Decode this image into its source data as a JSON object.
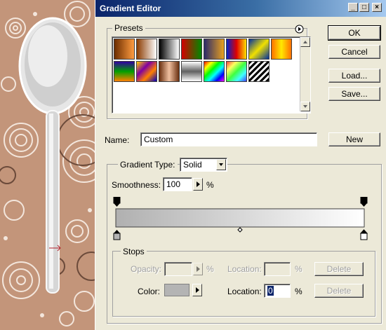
{
  "window": {
    "title": "Gradient Editor",
    "controls": [
      "_",
      "□",
      "×"
    ]
  },
  "presets": {
    "label": "Presets",
    "menu_icon": "circle-arrow-icon",
    "swatches": [
      {
        "name": "foreground-to-background",
        "css": "linear-gradient(90deg,#6b2d00,#ff9b40)"
      },
      {
        "name": "foreground-to-transparent",
        "css": "linear-gradient(90deg,#8b3b00,rgba(139,59,0,0))"
      },
      {
        "name": "black-white",
        "css": "linear-gradient(90deg,#000,#fff)"
      },
      {
        "name": "red-green",
        "css": "linear-gradient(90deg,#d40000,#008800)"
      },
      {
        "name": "violet-orange",
        "css": "linear-gradient(90deg,#2a2a6a,#e8a020)"
      },
      {
        "name": "blue-red-yellow",
        "css": "linear-gradient(90deg,#0022cc,#e00000,#ffe000)"
      },
      {
        "name": "blue-yellow-blue",
        "css": "linear-gradient(135deg,#0030a0,#f0e000 50%,#0030a0)"
      },
      {
        "name": "orange-yellow-orange",
        "css": "linear-gradient(90deg,#ff7000,#ffe800 50%,#ff7000)"
      },
      {
        "name": "violet-green-orange",
        "css": "linear-gradient(180deg,#3000a0,#00a000 50%,#ff8000)"
      },
      {
        "name": "yellow-violet-orange-blue",
        "css": "linear-gradient(135deg,#ffd000,#8000a0 35%,#ff8000 65%,#0000c0)"
      },
      {
        "name": "copper",
        "css": "linear-gradient(90deg,#6a3010,#f0c0a0 50%,#6a3010)"
      },
      {
        "name": "chrome",
        "css": "linear-gradient(180deg,#fff,#606060 50%,#fff)"
      },
      {
        "name": "spectrum",
        "css": "linear-gradient(135deg,#ff0000,#ffff00,#00ff00,#00ffff,#0000ff,#ff00ff)"
      },
      {
        "name": "transparent-rainbow",
        "css": "linear-gradient(135deg,#ff4040,#ffff60,#40ff40,#40ffff,#4040ff)"
      },
      {
        "name": "transparent-stripes",
        "css": "repeating-linear-gradient(135deg,#000 0 3px,#fff 3px 6px)"
      }
    ]
  },
  "buttons": {
    "ok": "OK",
    "cancel": "Cancel",
    "load": "Load...",
    "save": "Save...",
    "new": "New"
  },
  "name_field": {
    "label": "Name:",
    "value": "Custom"
  },
  "gradient_type": {
    "label": "Gradient Type:",
    "value": "Solid"
  },
  "smoothness": {
    "label": "Smoothness:",
    "value": "100",
    "unit": "%"
  },
  "stops": {
    "label": "Stops",
    "opacity_label": "Opacity:",
    "opacity_unit": "%",
    "opacity_location_label": "Location:",
    "opacity_location_unit": "%",
    "delete_label": "Delete",
    "color_label": "Color:",
    "color_value": "#b4b4b4",
    "color_location_label": "Location:",
    "color_location_value": "0",
    "color_location_unit": "%"
  },
  "gradient_bar": {
    "start_color": "#b0b0b0",
    "end_color": "#ffffff",
    "midpoint": 0.5
  },
  "colors": {
    "titlebar_start": "#0a246a",
    "titlebar_end": "#a6caf0",
    "dialog_bg": "#ece9d8",
    "canvas_bg": "#c3957a"
  }
}
